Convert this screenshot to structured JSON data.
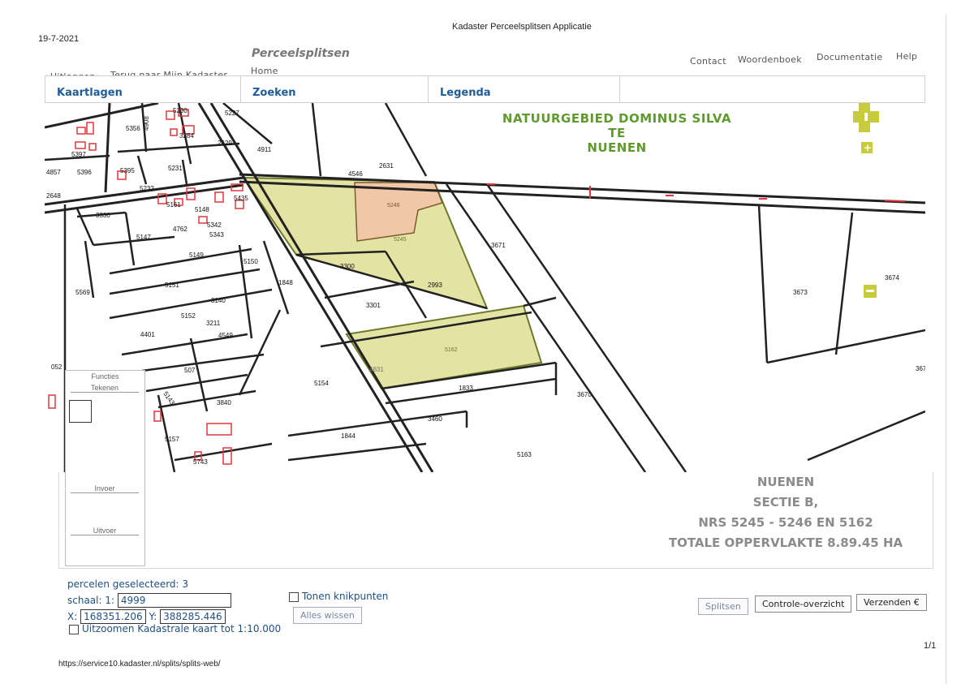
{
  "print": {
    "date": "19-7-2021",
    "doc_title": "Kadaster Perceelsplitsen Applicatie",
    "url": "https://service10.kadaster.nl/splits/splits-web/",
    "page": "1/1"
  },
  "header": {
    "app_title": "Perceelsplitsen",
    "nav_left": [
      "Uitloggen",
      "Terug naar Mijn Kadaster",
      "Home"
    ],
    "nav_right": [
      "Contact",
      "Woordenboek",
      "Documentatie",
      "Help"
    ]
  },
  "tabs": [
    "Kaartlagen",
    "Zoeken",
    "Legenda"
  ],
  "map": {
    "overlay_title": [
      "NATUURGEBIED DOMINUS SILVA",
      "TE",
      "NUENEN"
    ],
    "summary": [
      "NUENEN",
      "SECTIE B,",
      "NRS 5245 - 5246 EN 5162",
      "TOTALE OPPERVLAKTE 8.89.45 HA"
    ],
    "colors": {
      "selected": "#e3e3a4",
      "selected_hl": "#f0c8a8",
      "buildings": "#e0373f",
      "nav": "#c8cb3a",
      "overlay": "#5f9a2e"
    },
    "parcels": [
      "5356",
      "5230",
      "4908",
      "5227",
      "3284",
      "2629",
      "4911",
      "4546",
      "2631",
      "5397",
      "5396",
      "4857",
      "5395",
      "5231",
      "5232",
      "2648",
      "3330",
      "5161",
      "5148",
      "5435",
      "5342",
      "5343",
      "4762",
      "5147",
      "5149",
      "5150",
      "5569",
      "5151",
      "1848",
      "3140",
      "5152",
      "3211",
      "4549",
      "4401",
      "052",
      "507",
      "5143",
      "3840",
      "5154",
      "4831",
      "1833",
      "3460",
      "1844",
      "5157",
      "5743",
      "5163",
      "3670",
      "3671",
      "5246",
      "5245",
      "3300",
      "2993",
      "3301",
      "5162",
      "3673",
      "3674",
      "367"
    ]
  },
  "functions": {
    "title": "Functies",
    "tekenen": "Tekenen",
    "invoer": "Invoer",
    "uitvoer": "Uitvoer"
  },
  "bottom": {
    "selected_label": "percelen geselecteerd:",
    "selected_count": "3",
    "scale_label": "schaal:  1:",
    "scale_value": "4999",
    "x_label": "X:",
    "x_value": "168351.206",
    "y_label": "Y:",
    "y_value": "388285.446",
    "zoom_label": "Uitzoomen Kadastrale kaart tot 1:10.000",
    "knik_label": "Tonen knikpunten",
    "clear_button": "Alles wissen",
    "split_button": "Splitsen",
    "overview_button": "Controle-overzicht",
    "send_button": "Verzenden €"
  }
}
